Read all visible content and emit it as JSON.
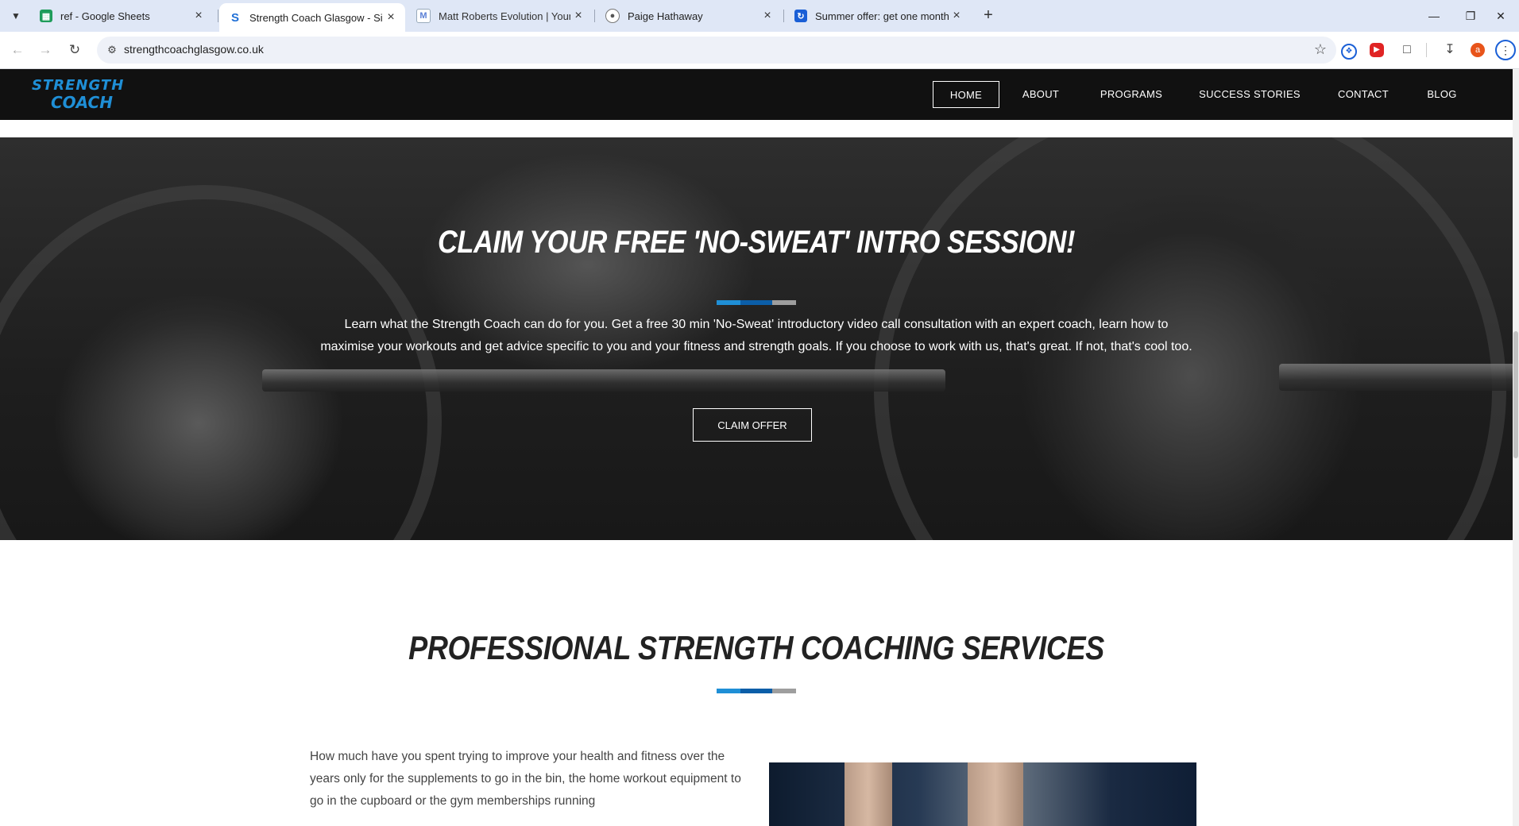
{
  "browser": {
    "tabs": [
      {
        "title": "ref - Google Sheets",
        "icon": "google-sheets-icon",
        "active": false
      },
      {
        "title": "Strength Coach Glasgow - Simp",
        "icon": "strength-coach-favicon",
        "active": true
      },
      {
        "title": "Matt Roberts Evolution | Young",
        "icon": "matt-roberts-favicon",
        "active": false
      },
      {
        "title": "Paige Hathaway",
        "icon": "globe-icon",
        "active": false
      },
      {
        "title": "Summer offer: get one month f",
        "icon": "offer-favicon",
        "active": false
      }
    ],
    "url": "strengthcoachglasgow.co.uk",
    "profile_initial": "a"
  },
  "site": {
    "logo": {
      "line1": "STRENGTH",
      "line2": "COACH"
    },
    "nav": [
      "HOME",
      "ABOUT",
      "PROGRAMS",
      "SUCCESS STORIES",
      "CONTACT",
      "BLOG"
    ],
    "active_nav": "HOME"
  },
  "hero": {
    "title": "CLAIM YOUR FREE 'NO-SWEAT' INTRO SESSION!",
    "text": "Learn what the Strength Coach can do for you. Get a free 30 min 'No-Sweat' introductory video call consultation with an expert coach, learn how to maximise your workouts and get advice specific to you and your fitness and strength goals. If you choose to work with us, that's great. If not, that's cool too.",
    "cta": "CLAIM OFFER"
  },
  "services": {
    "title": "PROFESSIONAL STRENGTH COACHING SERVICES",
    "text": "How much have you spent trying to improve your health and fitness over the years only for the supplements to go in the bin, the home workout equipment to go in the cupboard or the gym memberships running"
  },
  "colors": {
    "accent_blue": "#1f8fd6",
    "divider_dark_blue": "#0b5ea8",
    "divider_grey": "#9e9e9e",
    "header_bg": "#111111"
  }
}
